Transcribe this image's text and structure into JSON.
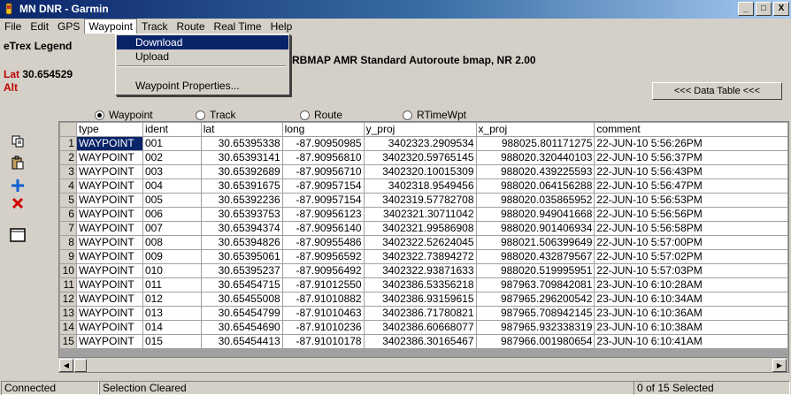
{
  "window": {
    "title": "MN DNR - Garmin",
    "controls": [
      "_",
      "□",
      "X"
    ]
  },
  "menubar": {
    "items": [
      "File",
      "Edit",
      "GPS",
      "Waypoint",
      "Track",
      "Route",
      "Real Time",
      "Help"
    ],
    "open": "Waypoint"
  },
  "dropdown": {
    "items": [
      "Download",
      "Upload",
      "Waypoint Properties..."
    ],
    "highlighted": "Download"
  },
  "header": {
    "device": "eTrex Legend",
    "map_info": "ERBMAP AMR Standard Autoroute bmap, NR 2.00",
    "lat_label": "Lat",
    "lat_value": "30.654529",
    "alt_label": "Alt"
  },
  "data_table_button": "<<< Data Table <<<",
  "radios": {
    "options": [
      "Waypoint",
      "Track",
      "Route",
      "RTimeWpt"
    ],
    "selected": "Waypoint"
  },
  "table": {
    "columns": [
      "type",
      "ident",
      "lat",
      "long",
      "y_proj",
      "x_proj",
      "comment"
    ],
    "rows": [
      [
        "1",
        "WAYPOINT",
        "001",
        "30.65395338",
        "-87.90950985",
        "3402323.2909534",
        "988025.801171275",
        "22-JUN-10 5:56:26PM"
      ],
      [
        "2",
        "WAYPOINT",
        "002",
        "30.65393141",
        "-87.90956810",
        "3402320.59765145",
        "988020.320440103",
        "22-JUN-10 5:56:37PM"
      ],
      [
        "3",
        "WAYPOINT",
        "003",
        "30.65392689",
        "-87.90956710",
        "3402320.10015309",
        "988020.439225593",
        "22-JUN-10 5:56:43PM"
      ],
      [
        "4",
        "WAYPOINT",
        "004",
        "30.65391675",
        "-87.90957154",
        "3402318.9549456",
        "988020.064156288",
        "22-JUN-10 5:56:47PM"
      ],
      [
        "5",
        "WAYPOINT",
        "005",
        "30.65392236",
        "-87.90957154",
        "3402319.57782708",
        "988020.035865952",
        "22-JUN-10 5:56:53PM"
      ],
      [
        "6",
        "WAYPOINT",
        "006",
        "30.65393753",
        "-87.90956123",
        "3402321.30711042",
        "988020.949041668",
        "22-JUN-10 5:56:56PM"
      ],
      [
        "7",
        "WAYPOINT",
        "007",
        "30.65394374",
        "-87.90956140",
        "3402321.99586908",
        "988020.901406934",
        "22-JUN-10 5:56:58PM"
      ],
      [
        "8",
        "WAYPOINT",
        "008",
        "30.65394826",
        "-87.90955486",
        "3402322.52624045",
        "988021.506399649",
        "22-JUN-10 5:57:00PM"
      ],
      [
        "9",
        "WAYPOINT",
        "009",
        "30.65395061",
        "-87.90956592",
        "3402322.73894272",
        "988020.432879567",
        "22-JUN-10 5:57:02PM"
      ],
      [
        "10",
        "WAYPOINT",
        "010",
        "30.65395237",
        "-87.90956492",
        "3402322.93871633",
        "988020.519995951",
        "22-JUN-10 5:57:03PM"
      ],
      [
        "11",
        "WAYPOINT",
        "011",
        "30.65454715",
        "-87.91012550",
        "3402386.53356218",
        "987963.709842081",
        "23-JUN-10 6:10:28AM"
      ],
      [
        "12",
        "WAYPOINT",
        "012",
        "30.65455008",
        "-87.91010882",
        "3402386.93159615",
        "987965.296200542",
        "23-JUN-10 6:10:34AM"
      ],
      [
        "13",
        "WAYPOINT",
        "013",
        "30.65454799",
        "-87.91010463",
        "3402386.71780821",
        "987965.708942145",
        "23-JUN-10 6:10:36AM"
      ],
      [
        "14",
        "WAYPOINT",
        "014",
        "30.65454690",
        "-87.91010236",
        "3402386.60668077",
        "987965.932338319",
        "23-JUN-10 6:10:38AM"
      ],
      [
        "15",
        "WAYPOINT",
        "015",
        "30.65454413",
        "-87.91010178",
        "3402386.30165467",
        "987966.001980654",
        "23-JUN-10 6:10:41AM"
      ]
    ]
  },
  "statusbar": {
    "connection": "Connected",
    "message": "Selection Cleared",
    "selection": "0 of 15 Selected"
  },
  "colors": {
    "title_start": "#0a246a",
    "title_end": "#a6caf0",
    "highlight": "#0a246a",
    "label_red": "#c00000"
  }
}
